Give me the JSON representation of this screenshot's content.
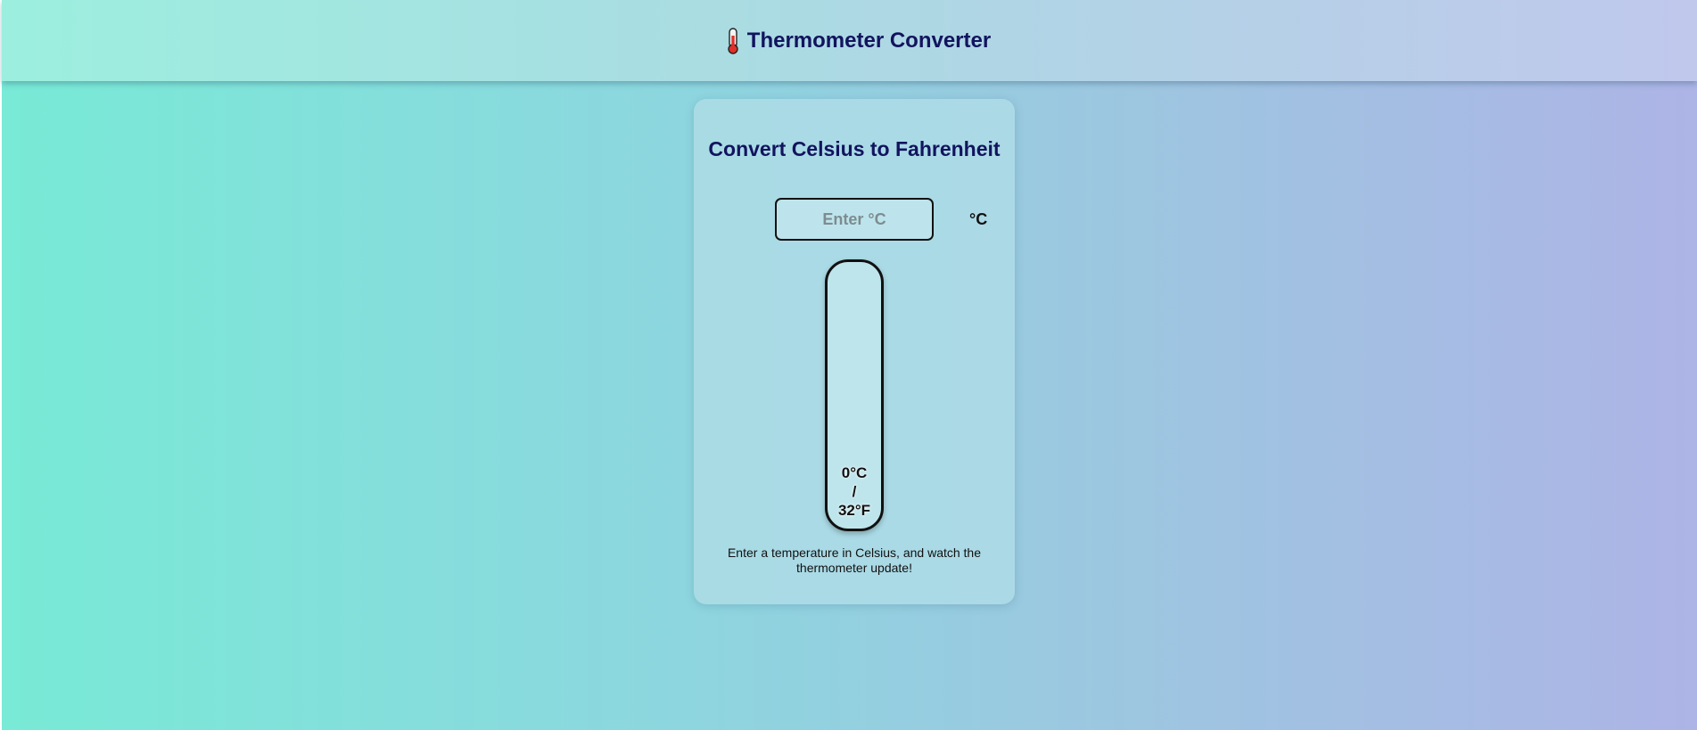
{
  "header": {
    "icon": "thermometer-icon",
    "title": "Thermometer Converter"
  },
  "card": {
    "heading": "Convert Celsius to Fahrenheit",
    "input": {
      "placeholder": "Enter °C",
      "value": ""
    },
    "unit_label": "°C",
    "thermometer": {
      "celsius": 0,
      "fahrenheit": 32,
      "reading": "0°C\n/\n32°F"
    },
    "hint": "Enter a temperature in Celsius, and watch the thermometer update!"
  },
  "colors": {
    "title": "#12145f",
    "thermometer_border": "#111111",
    "thermometer_mercury": "#e0302a"
  }
}
